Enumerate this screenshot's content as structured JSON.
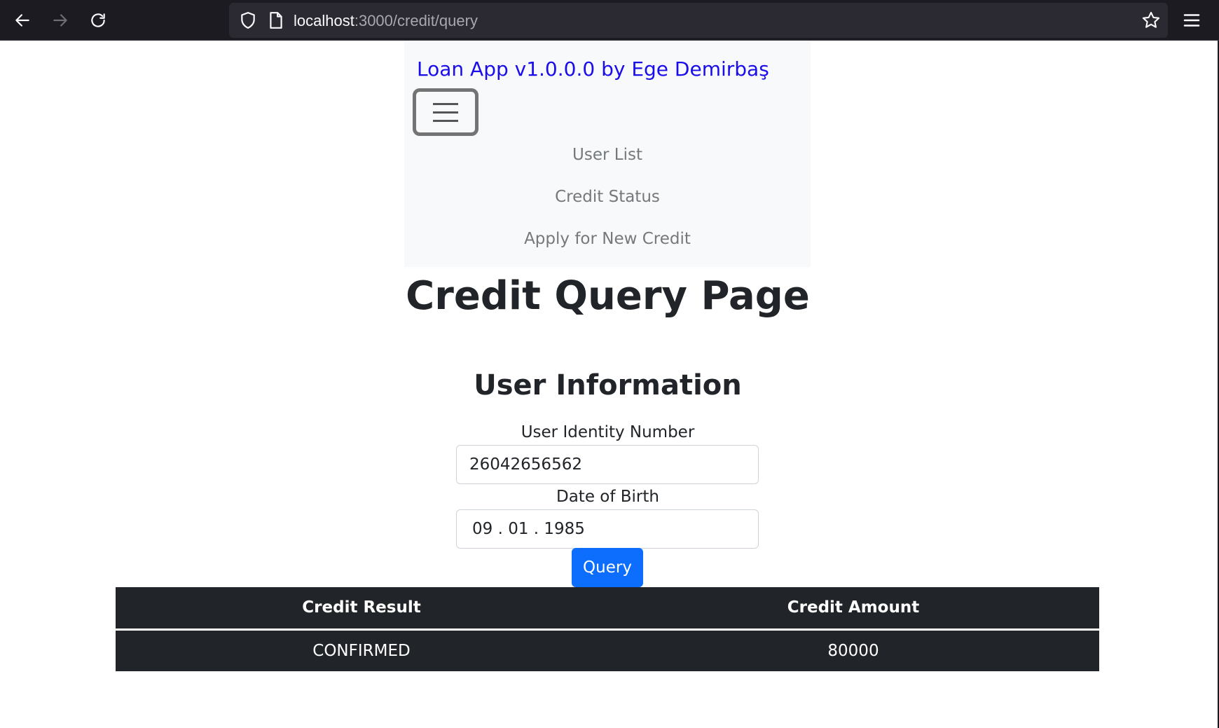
{
  "browser": {
    "url_host": "localhost",
    "url_path": ":3000/credit/query",
    "icons": [
      "back-arrow-icon",
      "forward-arrow-icon",
      "reload-icon",
      "shield-icon",
      "page-icon",
      "bookmark-star-icon",
      "hamburger-menu-icon"
    ]
  },
  "navbar": {
    "brand": "Loan App v1.0.0.0 by Ege Demirbaş",
    "links": [
      "User List",
      "Credit Status",
      "Apply for New Credit"
    ],
    "brand_color": "#1a0dea",
    "background": "#f8f9fa"
  },
  "main": {
    "title": "Credit Query Page",
    "section_title": "User Information",
    "identity_label": "User Identity Number",
    "identity_value": "26042656562",
    "dob_label": "Date of Birth",
    "dob_value": "09 . 01 . 1985",
    "query_button": "Query",
    "accent_color": "#0d6efd"
  },
  "results": {
    "headers": [
      "Credit Result",
      "Credit Amount"
    ],
    "rows": [
      [
        "CONFIRMED",
        "80000"
      ]
    ],
    "background": "#212529"
  }
}
